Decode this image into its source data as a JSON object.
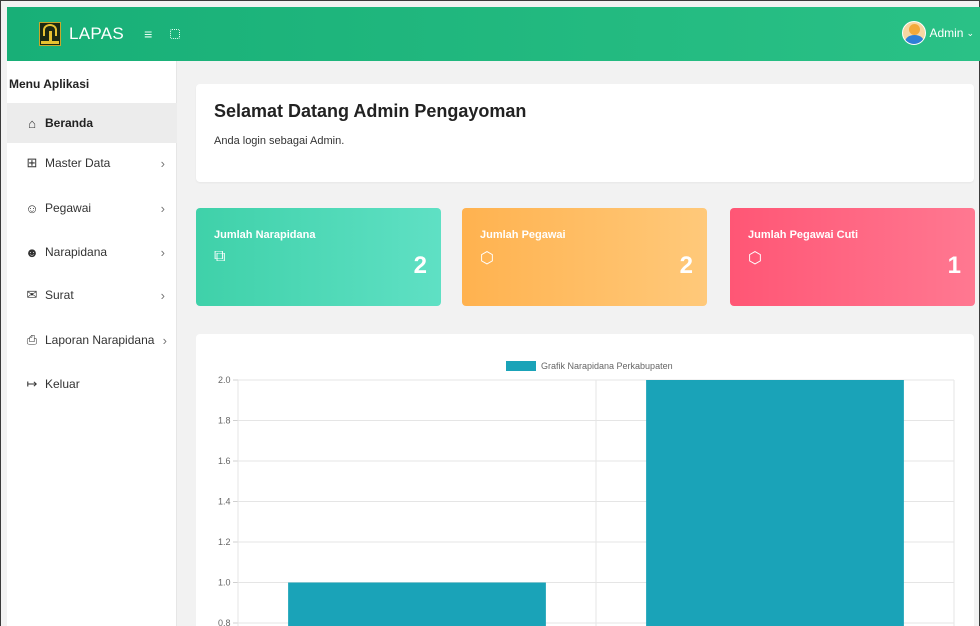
{
  "app": {
    "brand": "LAPAS",
    "user_name": "Admin"
  },
  "colors": {
    "topbar": "#1db57d",
    "bar": "#1aa3b8",
    "stat_green": "#4dd9b8",
    "stat_orange": "#ffbd62",
    "stat_red": "#ff6680"
  },
  "sidebar": {
    "title": "Menu Aplikasi",
    "items": [
      {
        "label": "Beranda",
        "icon": "home-icon",
        "has_submenu": false
      },
      {
        "label": "Master Data",
        "icon": "grid-icon",
        "has_submenu": true
      },
      {
        "label": "Pegawai",
        "icon": "users-icon",
        "has_submenu": true
      },
      {
        "label": "Narapidana",
        "icon": "user-plus-icon",
        "has_submenu": true
      },
      {
        "label": "Surat",
        "icon": "mail-icon",
        "has_submenu": true
      },
      {
        "label": "Laporan Narapidana",
        "icon": "printer-icon",
        "has_submenu": true
      },
      {
        "label": "Keluar",
        "icon": "logout-icon",
        "has_submenu": false
      }
    ]
  },
  "welcome": {
    "title": "Selamat Datang Admin Pengayoman",
    "subtitle": "Anda login sebagai Admin."
  },
  "stats": [
    {
      "title": "Jumlah Narapidana",
      "value": "2",
      "icon": "external-link-icon"
    },
    {
      "title": "Jumlah Pegawai",
      "value": "2",
      "icon": "box-icon"
    },
    {
      "title": "Jumlah Pegawai Cuti",
      "value": "1",
      "icon": "box-icon"
    }
  ],
  "chart_data": {
    "type": "bar",
    "categories": [
      "",
      ""
    ],
    "series": [
      {
        "name": "Grafik Narapidana Perkabupaten",
        "values": [
          1,
          2
        ]
      }
    ],
    "y_ticks": [
      "2.0",
      "1.8",
      "1.6",
      "1.4",
      "1.2",
      "1.0",
      "0.8"
    ],
    "ylim": [
      0.8,
      2.0
    ],
    "grid": true,
    "legend": "top-center"
  }
}
